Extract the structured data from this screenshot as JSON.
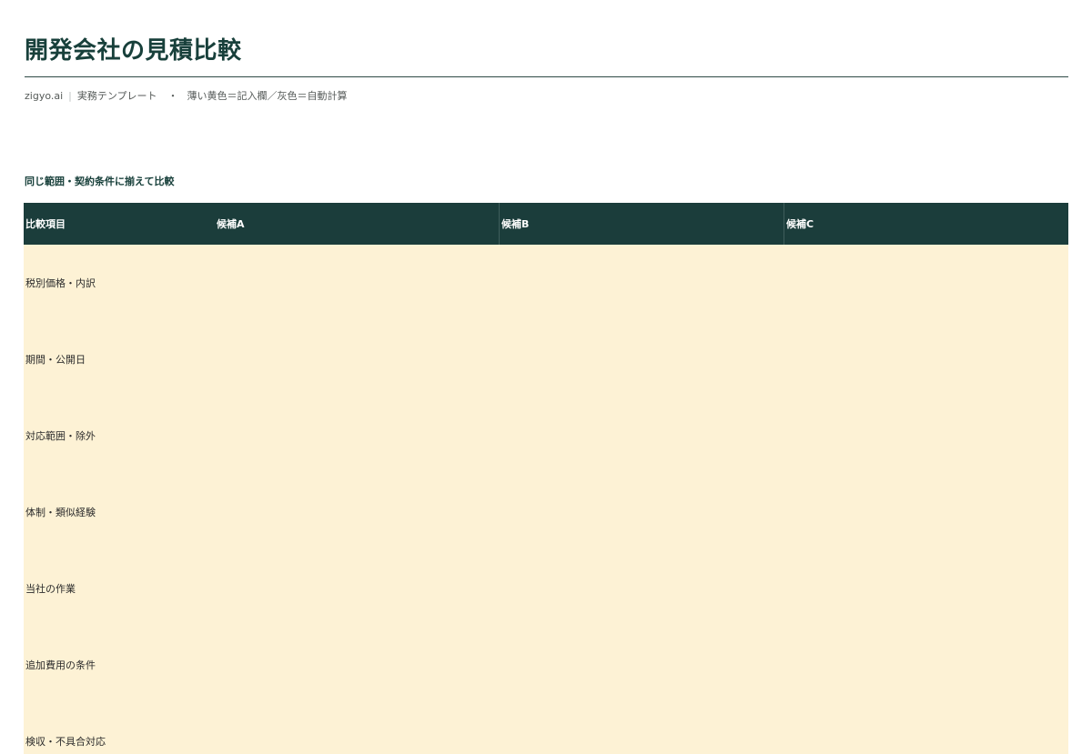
{
  "header": {
    "title": "開発会社の見積比較",
    "brand": "zigyo.ai",
    "separator": "|",
    "category": "実務テンプレート",
    "bullet": "・",
    "legend": "薄い黄色＝記入欄／灰色＝自動計算"
  },
  "section": {
    "heading": "同じ範囲・契約条件に揃えて比較"
  },
  "table": {
    "columns": [
      "比較項目",
      "候補A",
      "候補B",
      "候補C"
    ],
    "rows": [
      {
        "label": "税別価格・内訳",
        "values": [
          "",
          "",
          ""
        ]
      },
      {
        "label": "期間・公開日",
        "values": [
          "",
          "",
          ""
        ]
      },
      {
        "label": "対応範囲・除外",
        "values": [
          "",
          "",
          ""
        ]
      },
      {
        "label": "体制・類似経験",
        "values": [
          "",
          "",
          ""
        ]
      },
      {
        "label": "当社の作業",
        "values": [
          "",
          "",
          ""
        ]
      },
      {
        "label": "追加費用の条件",
        "values": [
          "",
          "",
          ""
        ]
      },
      {
        "label": "検収・不具合対応",
        "values": [
          "",
          "",
          ""
        ]
      }
    ]
  },
  "colors": {
    "header_bg": "#1b3d3b",
    "input_fill": "#fdf2d5",
    "title": "#18403b"
  }
}
